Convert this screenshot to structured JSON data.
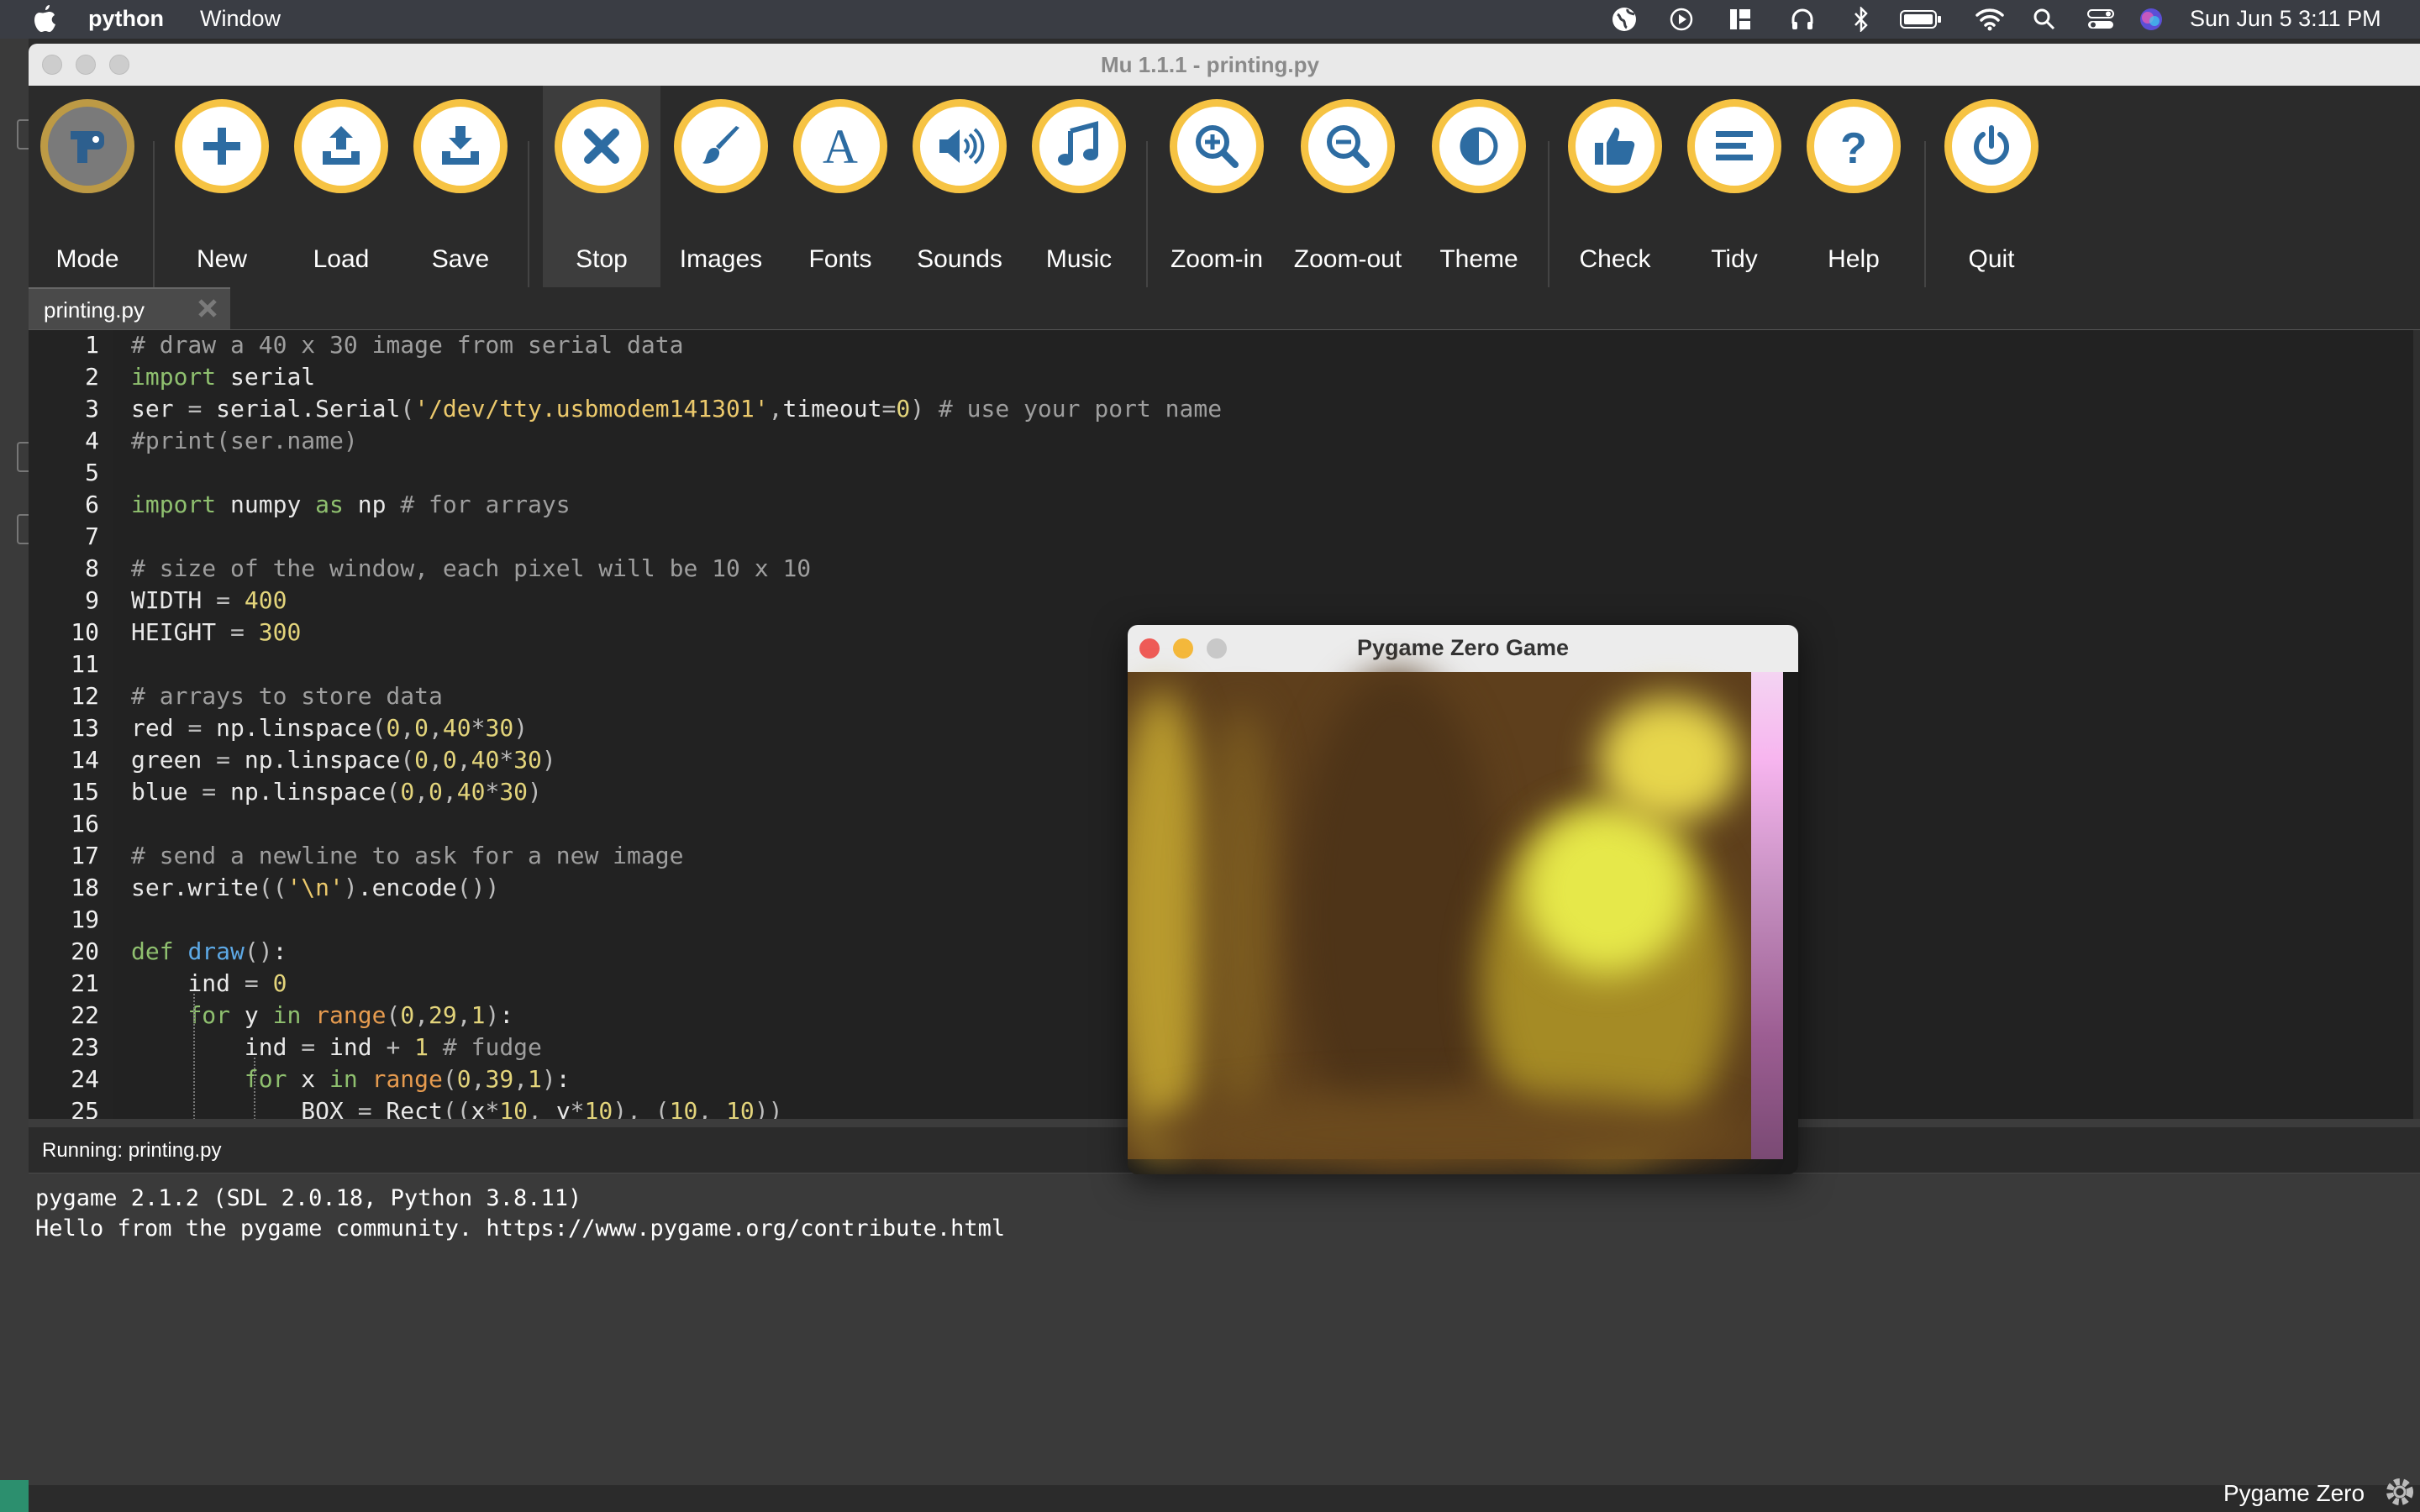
{
  "menubar": {
    "app_name": "python",
    "menu_window": "Window",
    "clock": "Sun Jun 5  3:11 PM",
    "status_icons": [
      "globe-icon",
      "play-circle-icon",
      "stage-manager-icon",
      "headphones-icon",
      "bluetooth-icon",
      "battery-icon",
      "wifi-icon",
      "search-icon",
      "control-center-icon",
      "siri-icon"
    ]
  },
  "window": {
    "title": "Mu 1.1.1 - printing.py"
  },
  "toolbar": {
    "buttons": [
      {
        "label": "Mode",
        "icon": "python-logo-icon"
      },
      {
        "label": "New",
        "icon": "plus-icon"
      },
      {
        "label": "Load",
        "icon": "upload-icon"
      },
      {
        "label": "Save",
        "icon": "download-icon"
      },
      {
        "label": "Stop",
        "icon": "x-icon"
      },
      {
        "label": "Images",
        "icon": "paintbrush-icon"
      },
      {
        "label": "Fonts",
        "icon": "font-a-icon"
      },
      {
        "label": "Sounds",
        "icon": "speaker-icon"
      },
      {
        "label": "Music",
        "icon": "music-note-icon"
      },
      {
        "label": "Zoom-in",
        "icon": "zoom-in-icon"
      },
      {
        "label": "Zoom-out",
        "icon": "zoom-out-icon"
      },
      {
        "label": "Theme",
        "icon": "half-circle-icon"
      },
      {
        "label": "Check",
        "icon": "thumbs-up-icon"
      },
      {
        "label": "Tidy",
        "icon": "lines-icon"
      },
      {
        "label": "Help",
        "icon": "question-icon"
      },
      {
        "label": "Quit",
        "icon": "power-icon"
      }
    ]
  },
  "tab": {
    "label": "printing.py"
  },
  "editor": {
    "line_numbers": [
      "1",
      "2",
      "3",
      "4",
      "5",
      "6",
      "7",
      "8",
      "9",
      "10",
      "11",
      "12",
      "13",
      "14",
      "15",
      "16",
      "17",
      "18",
      "19",
      "20",
      "21",
      "22",
      "23",
      "24",
      "25"
    ],
    "lines": [
      "# draw a 40 x 30 image from serial data",
      "import serial",
      "ser = serial.Serial('/dev/tty.usbmodem141301',timeout=0) # use your port name",
      "#print(ser.name)",
      "",
      "import numpy as np # for arrays",
      "",
      "# size of the window, each pixel will be 10 x 10",
      "WIDTH = 400",
      "HEIGHT = 300",
      "",
      "# arrays to store data",
      "red = np.linspace(0,0,40*30)",
      "green = np.linspace(0,0,40*30)",
      "blue = np.linspace(0,0,40*30)",
      "",
      "# send a newline to ask for a new image",
      "ser.write(('\\n').encode())",
      "",
      "def draw():",
      "    ind = 0",
      "    for y in range(0,29,1):",
      "        ind = ind + 1 # fudge",
      "        for x in range(0,39,1):",
      "            BOX = Rect((x*10, y*10), (10, 10))"
    ]
  },
  "output": {
    "header": "Running: printing.py",
    "lines": [
      "pygame 2.1.2 (SDL 2.0.18, Python 3.8.11)",
      "Hello from the pygame community. https://www.pygame.org/contribute.html"
    ]
  },
  "statusbar": {
    "mode": "Pygame Zero"
  },
  "pygame_window": {
    "title": "Pygame Zero Game"
  },
  "colors": {
    "accent": "#f6c343",
    "icon_blue": "#2d6ca2",
    "editor_bg": "#222222"
  }
}
